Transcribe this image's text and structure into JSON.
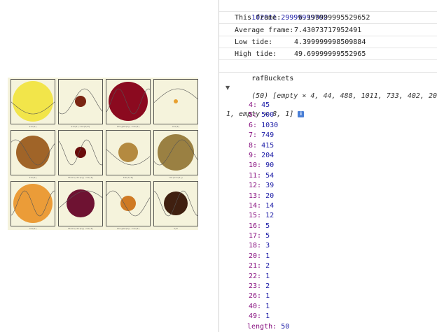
{
  "console": {
    "top_value": "102011.29999999702",
    "stats": [
      {
        "label": "This frame:",
        "value": "6.199999995529652"
      },
      {
        "label": "Average frame:",
        "value": "7.43073717952491"
      },
      {
        "label": "Low tide:",
        "value": "4.399999998509884"
      },
      {
        "label": "High tide:",
        "value": "49.69999999552965"
      }
    ],
    "raf_label": "rafBuckets",
    "array_preview_line1": "(50) [empty × 4, 44, 488, 1011, 733, 402, 201,",
    "array_preview_line2": "1, empty × 8, 1]",
    "info_icon_glyph": "i",
    "entries": [
      {
        "key": "4:",
        "value": "45"
      },
      {
        "key": "5:",
        "value": "500"
      },
      {
        "key": "6:",
        "value": "1030"
      },
      {
        "key": "7:",
        "value": "749"
      },
      {
        "key": "8:",
        "value": "415"
      },
      {
        "key": "9:",
        "value": "204"
      },
      {
        "key": "10:",
        "value": "90"
      },
      {
        "key": "11:",
        "value": "54"
      },
      {
        "key": "12:",
        "value": "39"
      },
      {
        "key": "13:",
        "value": "20"
      },
      {
        "key": "14:",
        "value": "14"
      },
      {
        "key": "15:",
        "value": "12"
      },
      {
        "key": "16:",
        "value": "5"
      },
      {
        "key": "17:",
        "value": "5"
      },
      {
        "key": "18:",
        "value": "3"
      },
      {
        "key": "20:",
        "value": "1"
      },
      {
        "key": "21:",
        "value": "2"
      },
      {
        "key": "22:",
        "value": "1"
      },
      {
        "key": "23:",
        "value": "2"
      },
      {
        "key": "26:",
        "value": "1"
      },
      {
        "key": "40:",
        "value": "1"
      },
      {
        "key": "49:",
        "value": "1"
      },
      {
        "key": "length:",
        "value": "50"
      }
    ]
  },
  "thumbnail": {
    "background": "#f5f3dc",
    "cells": [
      {
        "color": "#f2e54a",
        "label": "sin(t)"
      },
      {
        "color": "#7a2512",
        "label": "sin(t)·cos(t/2)"
      },
      {
        "color": "#8b0a1f",
        "label": "sin(pow(t))·cos(t)"
      },
      {
        "color": "#e8a030",
        "label": "cos(t)"
      },
      {
        "color": "#a06428",
        "label": "sin(t)"
      },
      {
        "color": "#6a0c0c",
        "label": "floor(sin(t))·cos(t)"
      },
      {
        "color": "#b48a40",
        "label": "tan(t/2)"
      },
      {
        "color": "#9a8042",
        "label": "cos(sin(t))"
      },
      {
        "color": "#eb9c38",
        "label": "cos(t)"
      },
      {
        "color": "#6e1232",
        "label": "floor(sin(t))·cos(t)"
      },
      {
        "color": "#cf7a24",
        "label": "sin(pow(t))·cos(t)"
      },
      {
        "color": "#402010",
        "label": "t/2"
      }
    ]
  }
}
